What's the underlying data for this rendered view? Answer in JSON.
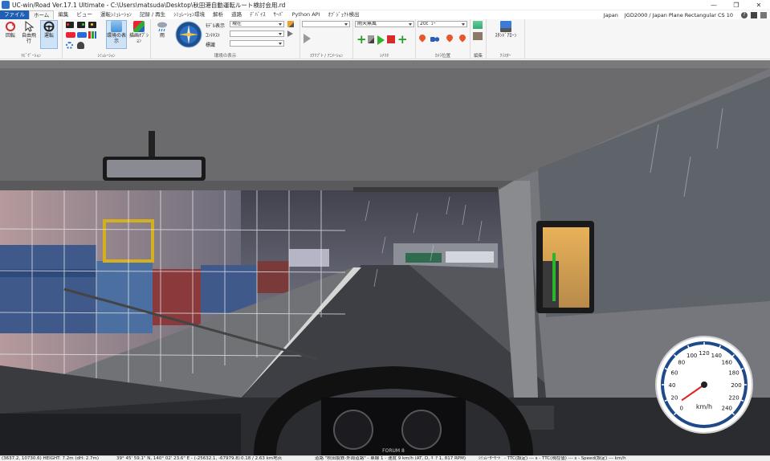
{
  "window": {
    "title": "UC-win/Road Ver.17.1 Ultimate - C:\\Users\\matsuda\\Desktop\\秋田港自動運転ルート検討会用.rd",
    "controls": [
      "—",
      "❐",
      "✕"
    ]
  },
  "menu": {
    "tabs": [
      "ファイル",
      "ホーム",
      "編集",
      "ビュー",
      "運転ｼﾐｭﾚｰｼｮﾝ",
      "記録 / 再生",
      "ｼﾐｭﾚｰｼｮﾝ環境",
      "解析",
      "道路",
      "ﾃﾞﾊﾞｲｽ",
      "ｻｰﾊﾞ",
      "Python API",
      "ｵﾌﾞｼﾞｪｸﾄ検出"
    ],
    "active_index": 1,
    "region": "Japan",
    "crs": "JGD2000 / Japan Plane Rectangular CS 10"
  },
  "ribbon": {
    "navigation": {
      "label": "ﾅﾋﾞｹﾞｰｼｮﾝ",
      "rotate": "回転",
      "free_flight": "自由飛行",
      "drive": "運転"
    },
    "simulation": {
      "label": "ｼﾐｭﾚｰｼｮﾝ",
      "env_display": "環境の表示",
      "drawing_option": "描画ｵﾌﾟｼｮﾝ"
    },
    "environment": {
      "label": "環境の表示",
      "weather": "雨",
      "model_display_label": "ﾓﾃﾞﾙ表示",
      "model_display_value": "現在",
      "context_label": "ｺﾝﾃｷｽﾄ",
      "context_value": "",
      "signs_label": "標識",
      "signs_value": ""
    },
    "script": {
      "label": "ｽｸﾘﾌﾟﾄ / ｱﾆﾒｰｼｮﾝ",
      "value": ""
    },
    "scenario": {
      "label": "ｼﾅﾘｵ",
      "value": "雨天無風"
    },
    "camera": {
      "label": "ｶﾒﾗ位置",
      "value": "20ﾋﾞｭｰ"
    },
    "edit": {
      "label": "編集"
    },
    "cluster": {
      "label": "ｸﾗｽﾀｰ",
      "standalone": "ｽﾀﾝﾄﾞｱﾛｰﾝ"
    }
  },
  "speedometer": {
    "ticks": [
      "0",
      "20",
      "40",
      "60",
      "80",
      "100",
      "120",
      "140",
      "160",
      "180",
      "200",
      "220",
      "240"
    ],
    "unit": "km/h",
    "value_kmh": 9
  },
  "cluster_brand": "FORUM 8",
  "status": {
    "coords": "(3637.2, 10730.6) HEIGHT: 7.2m (dH: 2.7m)",
    "latlon": "39° 45' 59.1\" N, 140° 02' 23.6\" E - (-25632.1, -67979.8)",
    "fps": "0.18 / 2.63 km地点",
    "drive_info": "道路 \"秋田製鉄-外周道路\" - 車線 1 - 速度 9 km/h (AT, D, ｷﾞｱ 1, 817 RPM)",
    "ttc": "ｼﾐｭﾚｰﾀｰﾓｰﾄﾞ - TTC(設定) --- s - TTC(現在値) --- s - Speed(設定) --- km/h"
  }
}
